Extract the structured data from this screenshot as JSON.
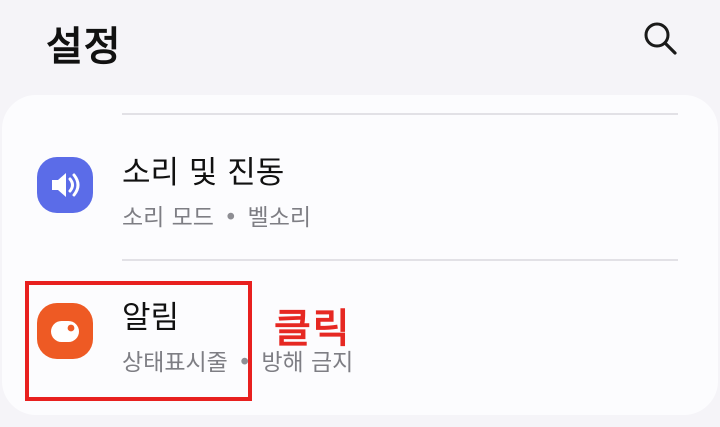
{
  "header": {
    "title": "설정",
    "search_icon": "search-icon"
  },
  "settings": {
    "items": [
      {
        "title": "소리 및 진동",
        "subtitle_parts": [
          "소리 모드",
          "벨소리"
        ],
        "icon": "speaker-icon",
        "icon_color": "#5b6ce8"
      },
      {
        "title": "알림",
        "subtitle_parts": [
          "상태표시줄",
          "방해 금지"
        ],
        "icon": "notification-icon",
        "icon_color": "#ee5a24"
      }
    ],
    "separator": "•"
  },
  "annotation": {
    "label": "클릭",
    "color": "#e62822"
  }
}
